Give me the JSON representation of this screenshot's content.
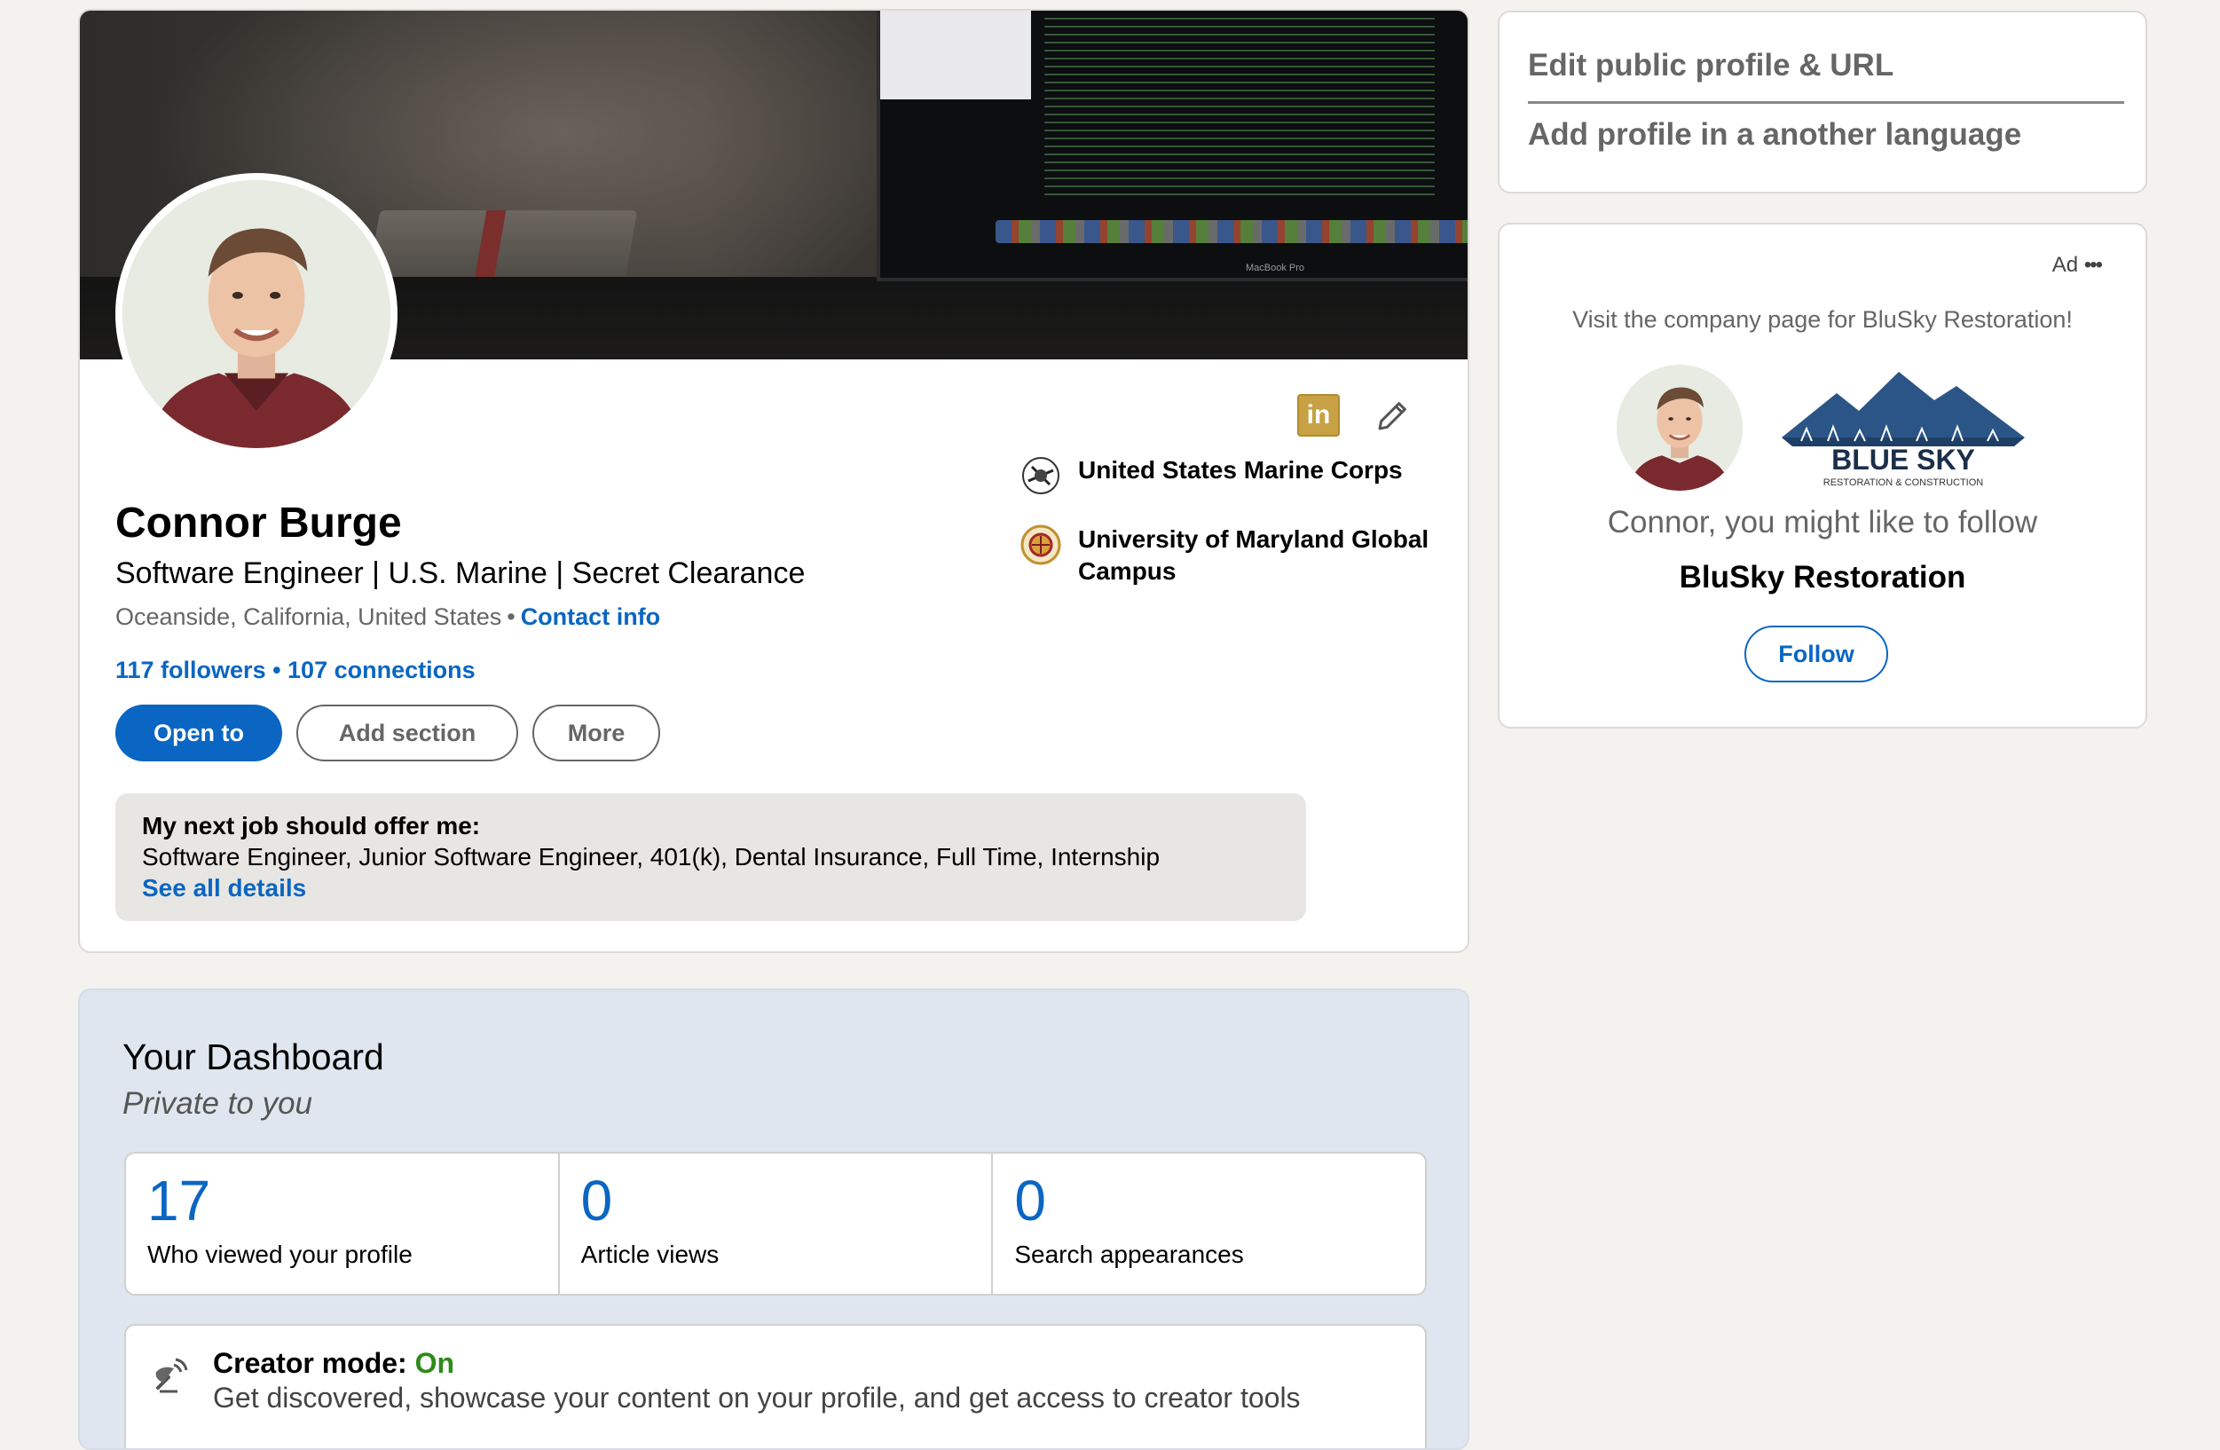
{
  "profile": {
    "name": "Connor Burge",
    "headline": "Software Engineer | U.S. Marine | Secret Clearance",
    "location": "Oceanside, California, United States",
    "separator": "•",
    "contact_label": "Contact info",
    "stats": "117 followers • 107 connections",
    "banner_brand": "MacBook Pro",
    "in_badge": "in",
    "orgs": [
      {
        "name": "United States Marine Corps",
        "icon": "marine-corps-emblem-icon"
      },
      {
        "name": "University of Maryland Global Campus",
        "icon": "umgc-seal-icon"
      }
    ],
    "buttons": {
      "open_to": "Open to",
      "add_section": "Add section",
      "more": "More"
    },
    "job_preferences": {
      "title": "My next job should offer me:",
      "text": "Software Engineer, Junior Software Engineer, 401(k), Dental Insurance, Full Time, Internship",
      "link": "See all details"
    }
  },
  "dashboard": {
    "title": "Your Dashboard",
    "subtitle": "Private to you",
    "metrics": [
      {
        "value": "17",
        "label": "Who viewed your profile"
      },
      {
        "value": "0",
        "label": "Article views"
      },
      {
        "value": "0",
        "label": "Search appearances"
      }
    ],
    "creator_mode": {
      "label": "Creator mode:",
      "status": "On",
      "description": "Get discovered, showcase your content on your profile, and get access to creator tools"
    }
  },
  "sidebar": {
    "links": [
      "Edit public profile & URL",
      "Add profile in a another language"
    ],
    "ad": {
      "label": "Ad",
      "more": "•••",
      "text": "Visit the company page for BluSky Restoration!",
      "logo_name": "BLUE SKY",
      "logo_sub": "RESTORATION & CONSTRUCTION",
      "tagline": "Connor, you might like to follow",
      "company": "BluSky Restoration",
      "follow_label": "Follow"
    }
  },
  "colors": {
    "accent": "#0a66c2",
    "creator_on": "#2f8a1a",
    "background": "#f3f2ef"
  }
}
